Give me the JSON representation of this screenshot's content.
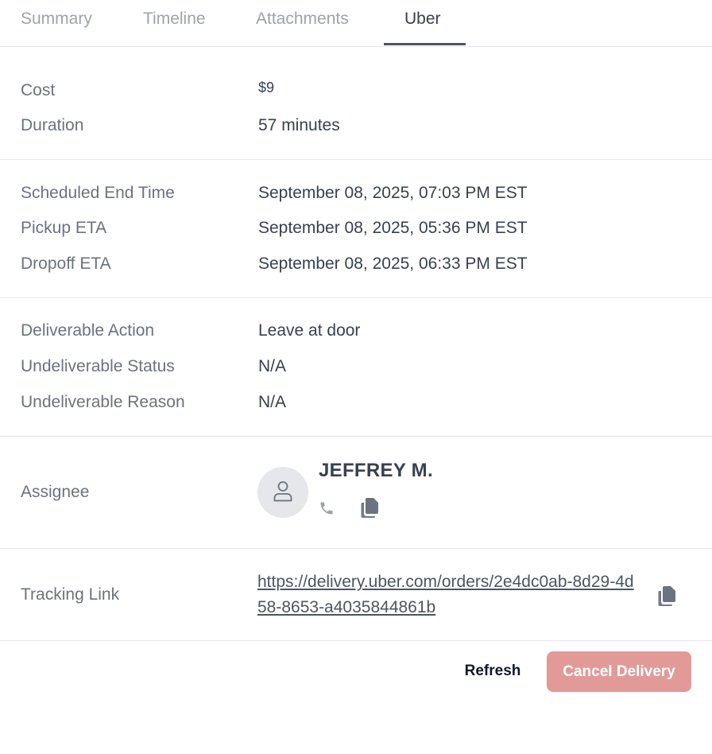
{
  "tabs": [
    {
      "label": "Summary"
    },
    {
      "label": "Timeline"
    },
    {
      "label": "Attachments"
    },
    {
      "label": "Uber"
    }
  ],
  "active_tab": "Uber",
  "details": {
    "cost": {
      "label": "Cost",
      "value": "$9"
    },
    "duration": {
      "label": "Duration",
      "value": "57 minutes"
    },
    "scheduled_end": {
      "label": "Scheduled End Time",
      "value": "September 08, 2025, 07:03 PM EST"
    },
    "pickup_eta": {
      "label": "Pickup ETA",
      "value": "September 08, 2025, 05:36 PM EST"
    },
    "dropoff_eta": {
      "label": "Dropoff ETA",
      "value": "September 08, 2025, 06:33 PM EST"
    },
    "deliverable_action": {
      "label": "Deliverable Action",
      "value": "Leave at door"
    },
    "undeliverable_status": {
      "label": "Undeliverable Status",
      "value": "N/A"
    },
    "undeliverable_reason": {
      "label": "Undeliverable Reason",
      "value": "N/A"
    }
  },
  "assignee": {
    "label": "Assignee",
    "name": "JEFFREY M.",
    "icons": [
      "user-icon",
      "phone-icon",
      "copy-icon"
    ]
  },
  "tracking": {
    "label": "Tracking Link",
    "url": "https://delivery.uber.com/orders/2e4dc0ab-8d29-4d58-8653-a4035844861b",
    "icon": "copy-icon"
  },
  "actions": {
    "refresh_label": "Refresh",
    "cancel_label": "Cancel Delivery"
  },
  "colors": {
    "cancel_button_bg": "#e29a98",
    "active_tab_underline": "#4b5563",
    "label_text": "#6b7280",
    "value_text": "#374151"
  }
}
